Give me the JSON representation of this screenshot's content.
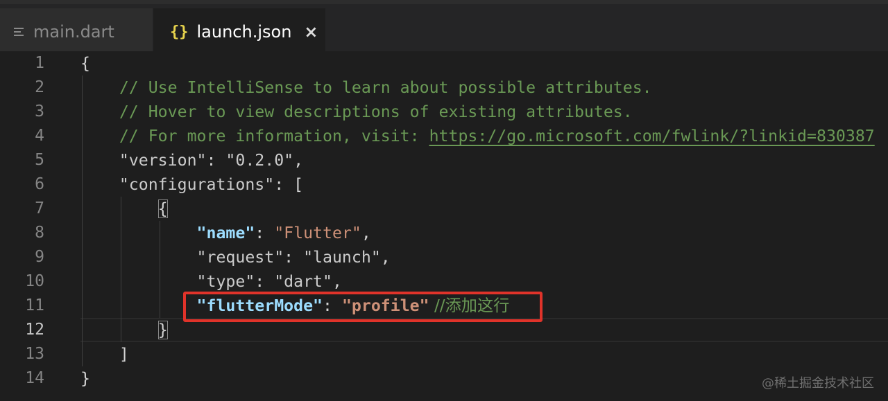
{
  "tabs": [
    {
      "label": "main.dart",
      "icon": "lines-icon",
      "glyph": "≡",
      "active": false
    },
    {
      "label": "launch.json",
      "icon": "braces-icon",
      "glyph": "{}",
      "active": true,
      "close_glyph": "×"
    }
  ],
  "line_numbers": [
    "1",
    "2",
    "3",
    "4",
    "5",
    "6",
    "7",
    "8",
    "9",
    "10",
    "11",
    "12",
    "13",
    "14"
  ],
  "active_line": "12",
  "code": {
    "l1": {
      "brace": "{"
    },
    "l2": {
      "comment": "// Use IntelliSense to learn about possible attributes."
    },
    "l3": {
      "comment": "// Hover to view descriptions of existing attributes."
    },
    "l4": {
      "comment": "// For more information, visit: ",
      "link": "https://go.microsoft.com/fwlink/?linkid=830387"
    },
    "l5": {
      "key": "\"version\"",
      "colon": ": ",
      "value": "\"0.2.0\"",
      "comma": ","
    },
    "l6": {
      "key": "\"configurations\"",
      "colon": ": ",
      "bracket": "["
    },
    "l7": {
      "brace": "{"
    },
    "l8": {
      "key": "\"name\"",
      "colon": ": ",
      "value": "\"Flutter\"",
      "comma": ","
    },
    "l9": {
      "key": "\"request\"",
      "colon": ": ",
      "value": "\"launch\"",
      "comma": ","
    },
    "l10": {
      "key": "\"type\"",
      "colon": ": ",
      "value": "\"dart\"",
      "comma": ","
    },
    "l11": {
      "key": "\"flutterMode\"",
      "colon": ": ",
      "value": "\"profile\"",
      "comment": " //添加这行"
    },
    "l12": {
      "brace": "}"
    },
    "l13": {
      "bracket": "]"
    },
    "l14": {
      "brace": "}"
    }
  },
  "watermark": "@稀土掘金技术社区",
  "colors": {
    "background": "#1e1e1e",
    "comment": "#6a9955",
    "string": "#ce9178",
    "key_highlight": "#9cdcfe",
    "highlight_box": "#e0332a",
    "json_icon": "#e8d44d"
  }
}
